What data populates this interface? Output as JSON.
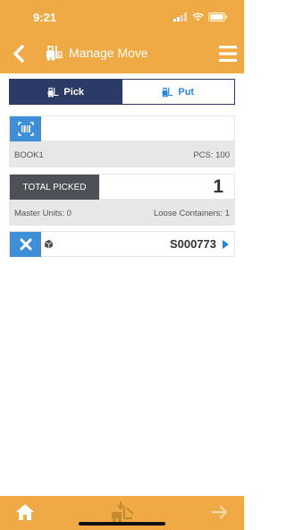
{
  "status_bar": {
    "time": "9:21"
  },
  "header": {
    "title": "Manage Move"
  },
  "mode_toggle": {
    "pick_label": "Pick",
    "put_label": "Put",
    "active": "Pick"
  },
  "scan": {
    "value": ""
  },
  "product": {
    "name": "BOOK1",
    "pcs": "PCS: 100"
  },
  "totals": {
    "label": "TOTAL PICKED",
    "value": "1",
    "master_units": "Master Units: 0",
    "loose_containers": "Loose Containers: 1"
  },
  "items": [
    {
      "id": "S000773"
    }
  ],
  "colors": {
    "header_bg": "#efaa45",
    "active_tab": "#2b3a67",
    "accent_blue": "#3e8fd8",
    "total_label_bg": "#4d5157"
  }
}
